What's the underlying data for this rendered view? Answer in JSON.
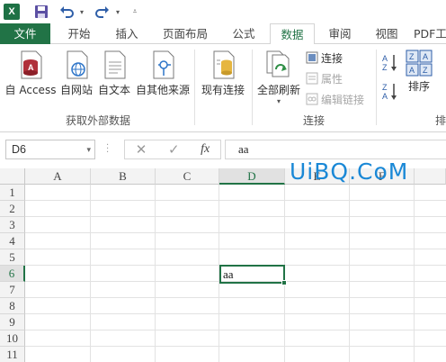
{
  "qat": {
    "logo_letter": "X",
    "save_icon": "save-icon",
    "undo_icon": "undo-icon",
    "redo_icon": "redo-icon",
    "customize_icon": "customize-qat-icon"
  },
  "tabs": [
    {
      "label": "文件"
    },
    {
      "label": "开始"
    },
    {
      "label": "插入"
    },
    {
      "label": "页面布局"
    },
    {
      "label": "公式"
    },
    {
      "label": "数据"
    },
    {
      "label": "审阅"
    },
    {
      "label": "视图"
    },
    {
      "label": "PDF工"
    }
  ],
  "active_tab": "数据",
  "ribbon": {
    "external": {
      "buttons": [
        {
          "label": "自 Access",
          "icon": "access-db-icon"
        },
        {
          "label": "自网站",
          "icon": "web-icon"
        },
        {
          "label": "自文本",
          "icon": "text-file-icon"
        },
        {
          "label": "自其他来源",
          "icon": "other-sources-icon"
        }
      ],
      "group_label": "获取外部数据"
    },
    "existing": {
      "label": "现有连接",
      "icon": "existing-connections-icon"
    },
    "connections": {
      "refresh_label": "全部刷新",
      "items": [
        "连接",
        "属性",
        "编辑链接"
      ],
      "group_label": "连接"
    },
    "sort": {
      "label": "排序",
      "sort_az_icon": "sort-ascending-icon",
      "sort_za_icon": "sort-descending-icon",
      "group_label": "排"
    }
  },
  "formula_bar": {
    "name_box": "D6",
    "fx_label": "fx",
    "cancel_icon": "cancel-icon",
    "enter_icon": "enter-icon",
    "formula_value": "aa"
  },
  "grid": {
    "columns": [
      "A",
      "B",
      "C",
      "D",
      "E",
      "F"
    ],
    "rows": [
      "1",
      "2",
      "3",
      "4",
      "5",
      "6",
      "7",
      "8",
      "9",
      "10",
      "11"
    ],
    "selected_column": "D",
    "selected_row": "6",
    "active_cell_value": "aa"
  },
  "watermark": "UiBQ.CoM",
  "colors": {
    "accent": "#217346",
    "watermark": "#1a88d6"
  }
}
